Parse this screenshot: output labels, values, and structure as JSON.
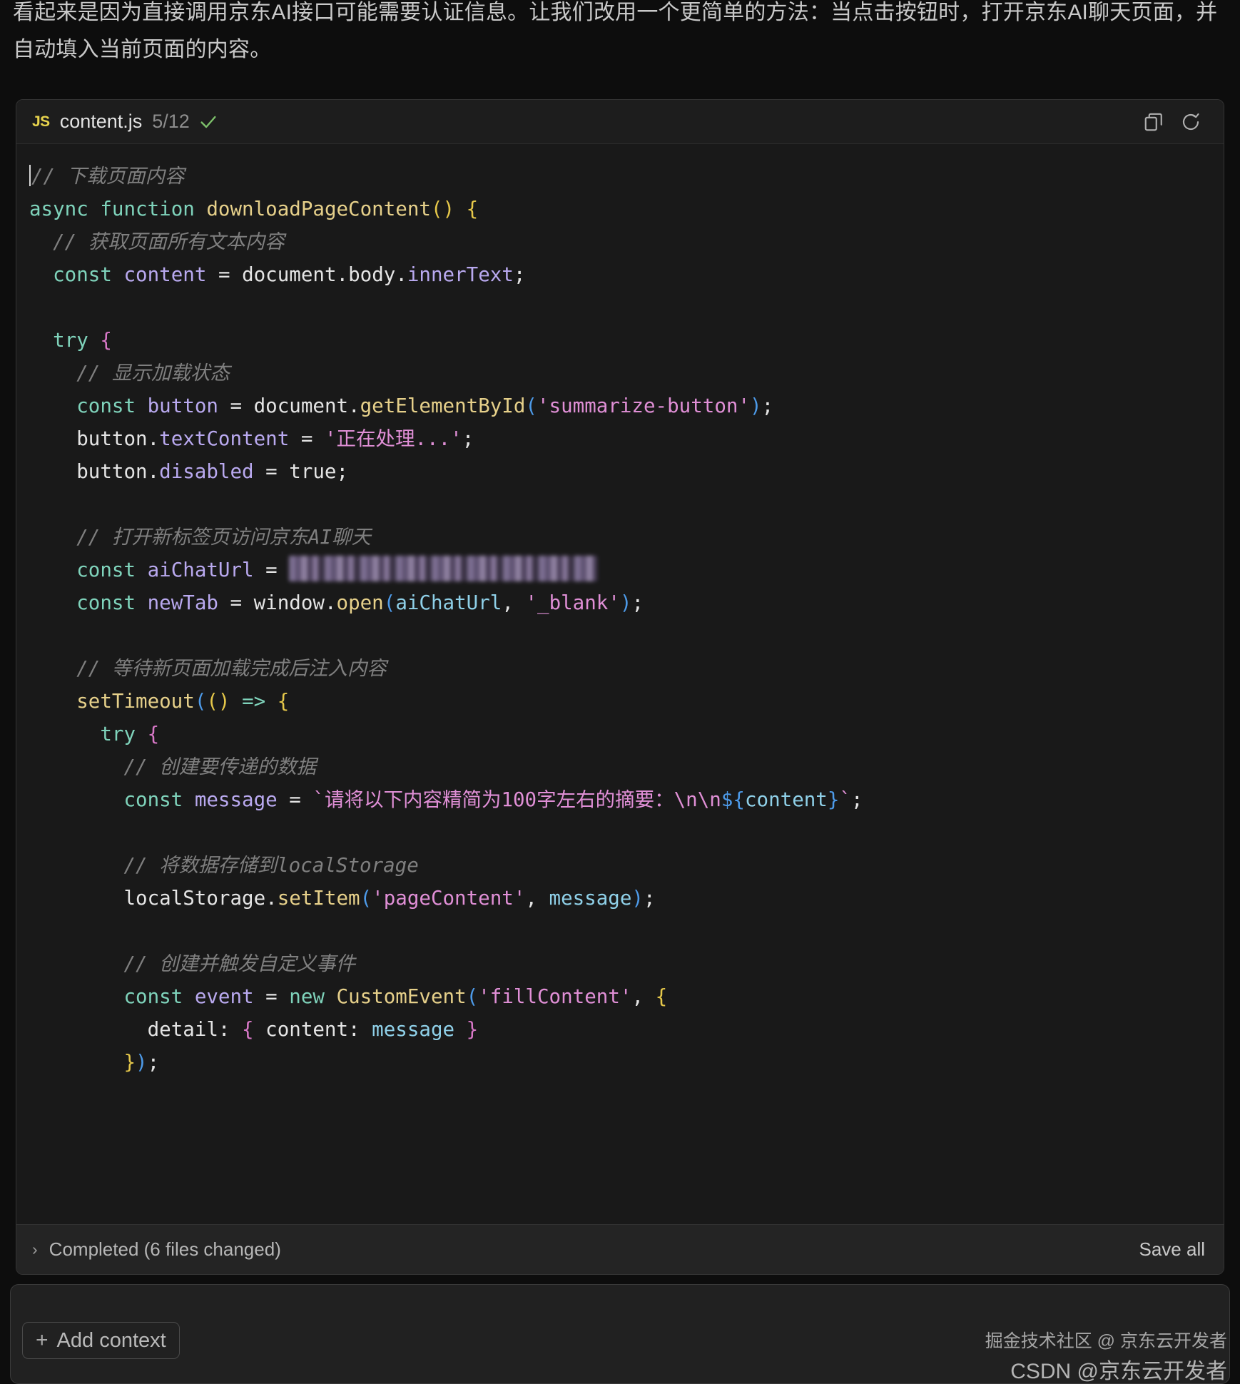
{
  "assistant_message": "看起来是因为直接调用京东AI接口可能需要认证信息。让我们改用一个更简单的方法：当点击按钮时，打开京东AI聊天页面，并自动填入当前页面的内容。",
  "code_card": {
    "header": {
      "language_badge": "JS",
      "file_name": "content.js",
      "progress": "5/12",
      "status_icon": "check-icon",
      "copy_icon": "copy-icon",
      "refresh_icon": "refresh-icon"
    },
    "lines": [
      {
        "indent": 0,
        "tokens": [
          {
            "t": "caret",
            "v": ""
          },
          {
            "t": "c",
            "v": "// 下载页面内容"
          }
        ]
      },
      {
        "indent": 0,
        "tokens": [
          {
            "t": "kw",
            "v": "async"
          },
          {
            "t": "pln",
            "v": " "
          },
          {
            "t": "kw",
            "v": "function"
          },
          {
            "t": "pln",
            "v": " "
          },
          {
            "t": "fn",
            "v": "downloadPageContent"
          },
          {
            "t": "b1",
            "v": "()"
          },
          {
            "t": "pln",
            "v": " "
          },
          {
            "t": "b1",
            "v": "{"
          }
        ]
      },
      {
        "indent": 1,
        "tokens": [
          {
            "t": "c",
            "v": "// 获取页面所有文本内容"
          }
        ]
      },
      {
        "indent": 1,
        "tokens": [
          {
            "t": "kw",
            "v": "const"
          },
          {
            "t": "pln",
            "v": " "
          },
          {
            "t": "var",
            "v": "content"
          },
          {
            "t": "pln",
            "v": " = "
          },
          {
            "t": "pln",
            "v": "document"
          },
          {
            "t": "pln",
            "v": "."
          },
          {
            "t": "pln",
            "v": "body"
          },
          {
            "t": "pln",
            "v": "."
          },
          {
            "t": "var",
            "v": "innerText"
          },
          {
            "t": "pln",
            "v": ";"
          }
        ]
      },
      {
        "indent": 0,
        "tokens": []
      },
      {
        "indent": 1,
        "tokens": [
          {
            "t": "kw",
            "v": "try"
          },
          {
            "t": "pln",
            "v": " "
          },
          {
            "t": "b2",
            "v": "{"
          }
        ]
      },
      {
        "indent": 2,
        "tokens": [
          {
            "t": "c",
            "v": "// 显示加载状态"
          }
        ]
      },
      {
        "indent": 2,
        "tokens": [
          {
            "t": "kw",
            "v": "const"
          },
          {
            "t": "pln",
            "v": " "
          },
          {
            "t": "var",
            "v": "button"
          },
          {
            "t": "pln",
            "v": " = "
          },
          {
            "t": "pln",
            "v": "document."
          },
          {
            "t": "fn",
            "v": "getElementById"
          },
          {
            "t": "b3",
            "v": "("
          },
          {
            "t": "str",
            "v": "'summarize-button'"
          },
          {
            "t": "b3",
            "v": ")"
          },
          {
            "t": "pln",
            "v": ";"
          }
        ]
      },
      {
        "indent": 2,
        "tokens": [
          {
            "t": "pln",
            "v": "button."
          },
          {
            "t": "var",
            "v": "textContent"
          },
          {
            "t": "pln",
            "v": " = "
          },
          {
            "t": "str",
            "v": "'正在处理...'"
          },
          {
            "t": "pln",
            "v": ";"
          }
        ]
      },
      {
        "indent": 2,
        "tokens": [
          {
            "t": "pln",
            "v": "button."
          },
          {
            "t": "var",
            "v": "disabled"
          },
          {
            "t": "pln",
            "v": " = "
          },
          {
            "t": "pln",
            "v": "true;"
          }
        ]
      },
      {
        "indent": 0,
        "tokens": []
      },
      {
        "indent": 2,
        "tokens": [
          {
            "t": "c",
            "v": "// 打开新标签页访问京东AI聊天"
          }
        ]
      },
      {
        "indent": 2,
        "tokens": [
          {
            "t": "kw",
            "v": "const"
          },
          {
            "t": "pln",
            "v": " "
          },
          {
            "t": "var",
            "v": "aiChatUrl"
          },
          {
            "t": "pln",
            "v": " = "
          },
          {
            "t": "redacted",
            "v": "[REDACTED URL]"
          }
        ]
      },
      {
        "indent": 2,
        "tokens": [
          {
            "t": "kw",
            "v": "const"
          },
          {
            "t": "pln",
            "v": " "
          },
          {
            "t": "var",
            "v": "newTab"
          },
          {
            "t": "pln",
            "v": " = "
          },
          {
            "t": "pln",
            "v": "window."
          },
          {
            "t": "fn",
            "v": "open"
          },
          {
            "t": "b3",
            "v": "("
          },
          {
            "t": "prm",
            "v": "aiChatUrl"
          },
          {
            "t": "pln",
            "v": ", "
          },
          {
            "t": "str",
            "v": "'_blank'"
          },
          {
            "t": "b3",
            "v": ")"
          },
          {
            "t": "pln",
            "v": ";"
          }
        ]
      },
      {
        "indent": 0,
        "tokens": []
      },
      {
        "indent": 2,
        "tokens": [
          {
            "t": "c",
            "v": "// 等待新页面加载完成后注入内容"
          }
        ]
      },
      {
        "indent": 2,
        "tokens": [
          {
            "t": "fn",
            "v": "setTimeout"
          },
          {
            "t": "b3",
            "v": "("
          },
          {
            "t": "b1",
            "v": "()"
          },
          {
            "t": "pln",
            "v": " "
          },
          {
            "t": "kw",
            "v": "=>"
          },
          {
            "t": "pln",
            "v": " "
          },
          {
            "t": "b1",
            "v": "{"
          }
        ]
      },
      {
        "indent": 3,
        "tokens": [
          {
            "t": "kw",
            "v": "try"
          },
          {
            "t": "pln",
            "v": " "
          },
          {
            "t": "b2",
            "v": "{"
          }
        ]
      },
      {
        "indent": 4,
        "tokens": [
          {
            "t": "c",
            "v": "// 创建要传递的数据"
          }
        ]
      },
      {
        "indent": 4,
        "tokens": [
          {
            "t": "kw",
            "v": "const"
          },
          {
            "t": "pln",
            "v": " "
          },
          {
            "t": "var",
            "v": "message"
          },
          {
            "t": "pln",
            "v": " = "
          },
          {
            "t": "str",
            "v": "`请将以下内容精简为100字左右的摘要：\\n\\n"
          },
          {
            "t": "b3",
            "v": "${"
          },
          {
            "t": "prm",
            "v": "content"
          },
          {
            "t": "b3",
            "v": "}"
          },
          {
            "t": "str",
            "v": "`"
          },
          {
            "t": "pln",
            "v": ";"
          }
        ]
      },
      {
        "indent": 0,
        "tokens": []
      },
      {
        "indent": 4,
        "tokens": [
          {
            "t": "c",
            "v": "// 将数据存储到localStorage"
          }
        ]
      },
      {
        "indent": 4,
        "tokens": [
          {
            "t": "pln",
            "v": "localStorage."
          },
          {
            "t": "fn",
            "v": "setItem"
          },
          {
            "t": "b3",
            "v": "("
          },
          {
            "t": "str",
            "v": "'pageContent'"
          },
          {
            "t": "pln",
            "v": ", "
          },
          {
            "t": "prm",
            "v": "message"
          },
          {
            "t": "b3",
            "v": ")"
          },
          {
            "t": "pln",
            "v": ";"
          }
        ]
      },
      {
        "indent": 0,
        "tokens": []
      },
      {
        "indent": 4,
        "tokens": [
          {
            "t": "c",
            "v": "// 创建并触发自定义事件"
          }
        ]
      },
      {
        "indent": 4,
        "tokens": [
          {
            "t": "kw",
            "v": "const"
          },
          {
            "t": "pln",
            "v": " "
          },
          {
            "t": "var",
            "v": "event"
          },
          {
            "t": "pln",
            "v": " = "
          },
          {
            "t": "kw",
            "v": "new"
          },
          {
            "t": "pln",
            "v": " "
          },
          {
            "t": "fn",
            "v": "CustomEvent"
          },
          {
            "t": "b3",
            "v": "("
          },
          {
            "t": "str",
            "v": "'fillContent'"
          },
          {
            "t": "pln",
            "v": ", "
          },
          {
            "t": "b1",
            "v": "{"
          }
        ]
      },
      {
        "indent": 5,
        "tokens": [
          {
            "t": "pln",
            "v": "detail: "
          },
          {
            "t": "b2",
            "v": "{"
          },
          {
            "t": "pln",
            "v": " content: "
          },
          {
            "t": "prm",
            "v": "message"
          },
          {
            "t": "pln",
            "v": " "
          },
          {
            "t": "b2",
            "v": "}"
          }
        ]
      },
      {
        "indent": 4,
        "tokens": [
          {
            "t": "b1",
            "v": "}"
          },
          {
            "t": "b3",
            "v": ")"
          },
          {
            "t": "pln",
            "v": ";"
          }
        ]
      }
    ],
    "footer": {
      "expand_icon": "chevron-right-icon",
      "status": "Completed (6 files changed)",
      "save_all_label": "Save all"
    }
  },
  "composer": {
    "add_context_label": "Add context",
    "add_context_icon": "plus-icon"
  },
  "watermarks": {
    "line1": "掘金技术社区 @ 京东云开发者",
    "line2": "CSDN @京东云开发者"
  },
  "colors": {
    "background": "#0d0d0d",
    "card_background": "#191919",
    "card_header": "#1d1d1d",
    "card_footer": "#242424",
    "border": "#333333",
    "comment": "#7f7f7f",
    "keyword": "#7fd3bb",
    "function": "#e6d08a",
    "variable": "#b9a9ef",
    "string": "#e08fd6",
    "parameter": "#8fd0e8",
    "bracket_yellow": "#e6c84a",
    "bracket_pink": "#d978c8",
    "bracket_blue": "#4d9ae8",
    "js_badge": "#e8d44d",
    "check_green": "#7cbf6a"
  }
}
